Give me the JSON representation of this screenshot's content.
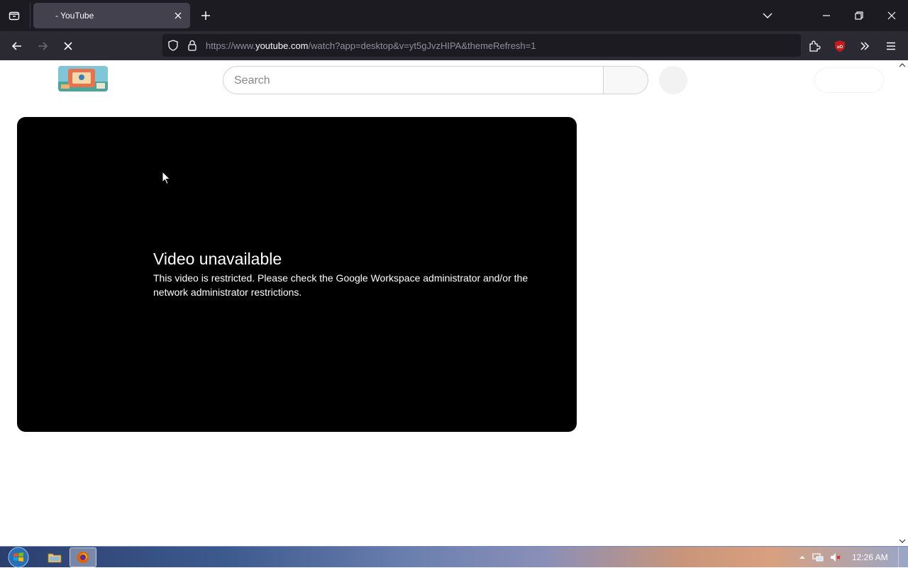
{
  "browser": {
    "tab_title": "- YouTube",
    "url_prefix": "https://www.",
    "url_host": "youtube.com",
    "url_path": "/watch?app=desktop&v=yt5gJvzHIPA&themeRefresh=1"
  },
  "youtube": {
    "search_placeholder": "Search"
  },
  "player": {
    "error_title": "Video unavailable",
    "error_message": "This video is restricted. Please check the Google Workspace administrator and/or the network administrator restrictions."
  },
  "taskbar": {
    "clock": "12:26 AM"
  },
  "colors": {
    "chrome_dark": "#1c1b22",
    "toolbar": "#2b2a33",
    "tab_active": "#42414d",
    "ublock_red": "#c41b1b"
  }
}
